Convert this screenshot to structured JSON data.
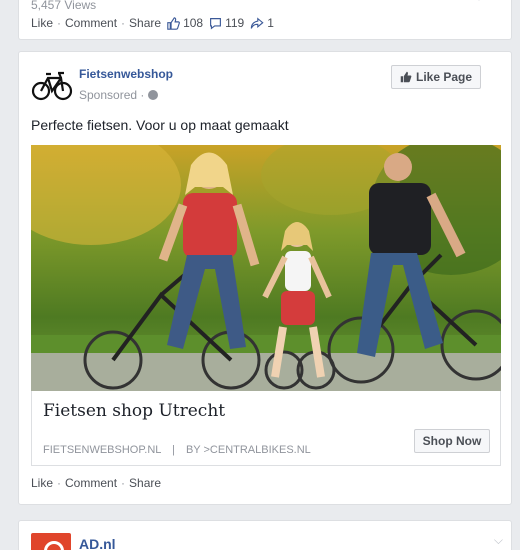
{
  "prev_post": {
    "views": "5,457 Views",
    "actions": [
      "Like",
      "Comment",
      "Share"
    ],
    "likes": "108",
    "comments": "119",
    "shares": "1"
  },
  "ad": {
    "page_name": "Fietsenwebshop",
    "sponsored": "Sponsored ·",
    "like_page_label": "Like Page",
    "text": "Perfecte fietsen. Voor u op maat gemaakt",
    "headline": "Fietsen shop Utrecht",
    "display_url": "FIETSENWEBSHOP.NL",
    "by_label": "BY >CENTRALBIKES.NL",
    "cta_label": "Shop Now",
    "actions": [
      "Like",
      "Comment",
      "Share"
    ]
  },
  "next_post": {
    "page_name": "AD.nl"
  },
  "colors": {
    "link": "#365899",
    "meta": "#90949c",
    "background": "#e9ebee"
  }
}
